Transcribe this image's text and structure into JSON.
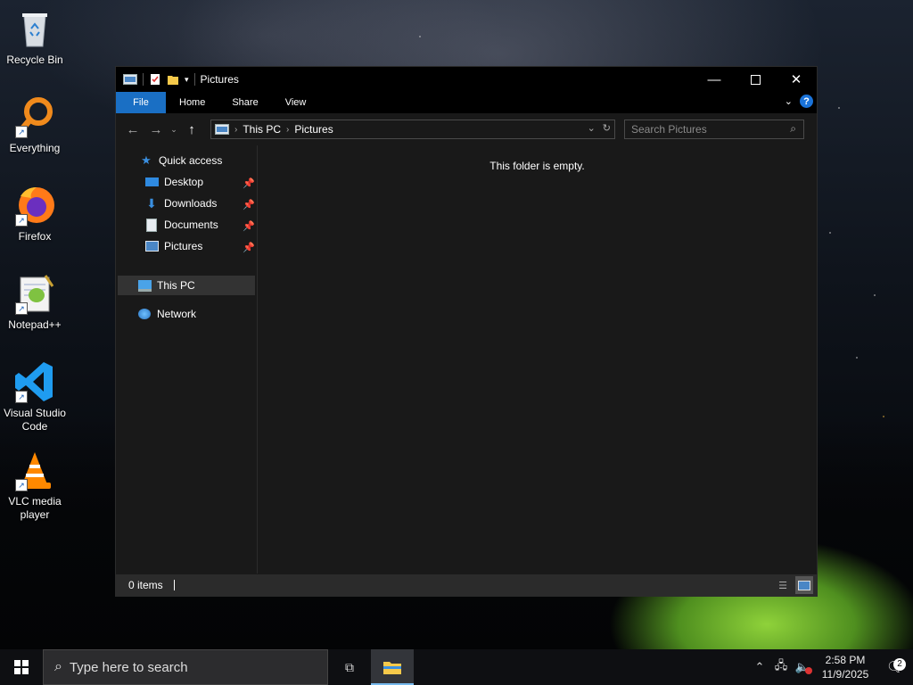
{
  "desktop": {
    "icons": [
      {
        "label": "Recycle Bin",
        "icon": "recycle-bin-icon"
      },
      {
        "label": "Everything",
        "icon": "everything-search-icon"
      },
      {
        "label": "Firefox",
        "icon": "firefox-icon"
      },
      {
        "label": "Notepad++",
        "icon": "notepad-plus-plus-icon"
      },
      {
        "label": "Visual Studio Code",
        "icon": "vscode-icon"
      },
      {
        "label": "VLC media player",
        "icon": "vlc-icon"
      }
    ]
  },
  "window": {
    "title": "Pictures",
    "ribbon_tabs": [
      "File",
      "Home",
      "Share",
      "View"
    ],
    "breadcrumb": [
      "This PC",
      "Pictures"
    ],
    "search_placeholder": "Search Pictures",
    "empty_message": "This folder is empty.",
    "status": "0 items",
    "nav": {
      "quick_access": "Quick access",
      "pinned": [
        "Desktop",
        "Downloads",
        "Documents",
        "Pictures"
      ],
      "this_pc": "This PC",
      "network": "Network"
    },
    "colors": {
      "accent": "#1a6fc4",
      "background": "#191919"
    }
  },
  "taskbar": {
    "search_placeholder": "Type here to search",
    "time": "2:58 PM",
    "date": "11/9/2025",
    "notification_count": "2"
  }
}
